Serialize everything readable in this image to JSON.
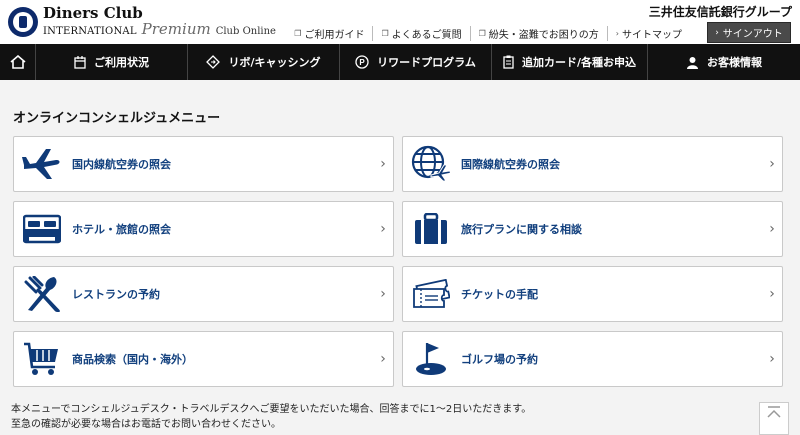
{
  "header": {
    "logo": {
      "line1": "Diners Club",
      "intl": "INTERNATIONAL",
      "premium": "Premium",
      "online": "Club Online"
    },
    "bank": "三井住友信託銀行グループ",
    "utility": [
      {
        "label": "ご利用ガイド",
        "icon": "window-icon"
      },
      {
        "label": "よくあるご質問",
        "icon": "window-icon"
      },
      {
        "label": "紛失・盗難でお困りの方",
        "icon": "window-icon"
      },
      {
        "label": "サイトマップ",
        "icon": "chevron-icon"
      }
    ],
    "signout": "サインアウト"
  },
  "nav": [
    {
      "label": "",
      "icon": "home-icon"
    },
    {
      "label": "ご利用状況",
      "icon": "calendar-icon"
    },
    {
      "label": "リボ/キャッシング",
      "icon": "revolving-icon"
    },
    {
      "label": "リワードプログラム",
      "icon": "points-icon"
    },
    {
      "label": "追加カード/各種お申込",
      "icon": "form-icon"
    },
    {
      "label": "お客様情報",
      "icon": "user-icon"
    }
  ],
  "content": {
    "title": "オンラインコンシェルジュメニュー",
    "cards": [
      {
        "label": "国内線航空券の照会",
        "icon": "airplane-icon"
      },
      {
        "label": "国際線航空券の照会",
        "icon": "globe-airplane-icon"
      },
      {
        "label": "ホテル・旅館の照会",
        "icon": "bed-icon"
      },
      {
        "label": "旅行プランに関する相談",
        "icon": "suitcase-icon"
      },
      {
        "label": "レストランの予約",
        "icon": "fork-knife-icon"
      },
      {
        "label": "チケットの手配",
        "icon": "ticket-icon"
      },
      {
        "label": "商品検索（国内・海外）",
        "icon": "cart-icon"
      },
      {
        "label": "ゴルフ場の予約",
        "icon": "golf-icon"
      }
    ],
    "note_line1": "本メニューでコンシェルジュデスク・トラベルデスクへご要望をいただいた場合、回答までに1～2日いただきます。",
    "note_line2": "至急の確認が必要な場合はお電話でお問い合わせください。"
  },
  "colors": {
    "accent": "#12407e",
    "nav_bg": "#111111",
    "brand": "#0d2a6b"
  }
}
